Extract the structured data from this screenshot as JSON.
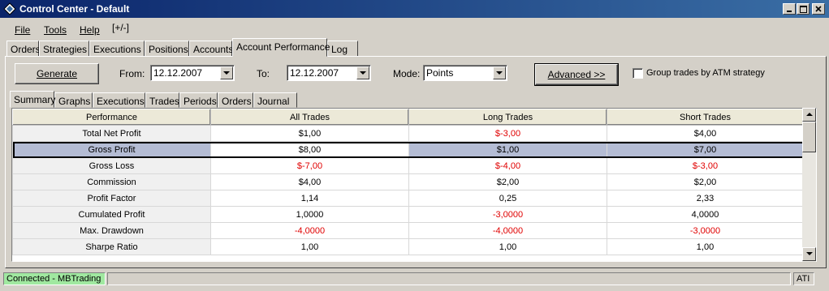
{
  "window": {
    "title": "Control Center - Default",
    "title_gradient": [
      "#0a246a",
      "#3a6ea5"
    ]
  },
  "menu": [
    "File",
    "Tools",
    "Help",
    "[+/-]"
  ],
  "top_tabs": [
    "Orders",
    "Strategies",
    "Executions",
    "Positions",
    "Accounts",
    "Account Performance",
    "Log"
  ],
  "active_top_tab": "Account Performance",
  "toolbar": {
    "generate_label": "Generate",
    "from_label": "From:",
    "from_value": "12.12.2007",
    "to_label": "To:",
    "to_value": "12.12.2007",
    "mode_label": "Mode:",
    "mode_value": "Points",
    "advanced_label": "Advanced >>",
    "group_trades_label": "Group trades by ATM strategy",
    "group_trades_checked": false
  },
  "sub_tabs": [
    "Summary",
    "Graphs",
    "Executions",
    "Trades",
    "Periods",
    "Orders",
    "Journal"
  ],
  "active_sub_tab": "Summary",
  "grid": {
    "columns": [
      "Performance",
      "All Trades",
      "Long Trades",
      "Short Trades"
    ],
    "rows": [
      {
        "metric": "Total Net Profit",
        "all": "$1,00",
        "long": "$-3,00",
        "short": "$4,00",
        "neg": [
          false,
          true,
          false
        ]
      },
      {
        "metric": "Gross Profit",
        "all": "$8,00",
        "long": "$1,00",
        "short": "$7,00",
        "neg": [
          false,
          false,
          false
        ],
        "selected": true
      },
      {
        "metric": "Gross Loss",
        "all": "$-7,00",
        "long": "$-4,00",
        "short": "$-3,00",
        "neg": [
          true,
          true,
          true
        ]
      },
      {
        "metric": "Commission",
        "all": "$4,00",
        "long": "$2,00",
        "short": "$2,00",
        "neg": [
          false,
          false,
          false
        ]
      },
      {
        "metric": "Profit Factor",
        "all": "1,14",
        "long": "0,25",
        "short": "2,33",
        "neg": [
          false,
          false,
          false
        ]
      },
      {
        "metric": "Cumulated Profit",
        "all": "1,0000",
        "long": "-3,0000",
        "short": "4,0000",
        "neg": [
          false,
          true,
          false
        ]
      },
      {
        "metric": "Max. Drawdown",
        "all": "-4,0000",
        "long": "-4,0000",
        "short": "-3,0000",
        "neg": [
          true,
          true,
          true
        ]
      },
      {
        "metric": "Sharpe Ratio",
        "all": "1,00",
        "long": "1,00",
        "short": "1,00",
        "neg": [
          false,
          false,
          false
        ]
      }
    ],
    "negative_color": "#e00000",
    "selection_color": "#b4bcd4"
  },
  "status": {
    "connection": "Connected - MBTrading",
    "connection_color": "#a0e8a0",
    "right": "ATI"
  }
}
